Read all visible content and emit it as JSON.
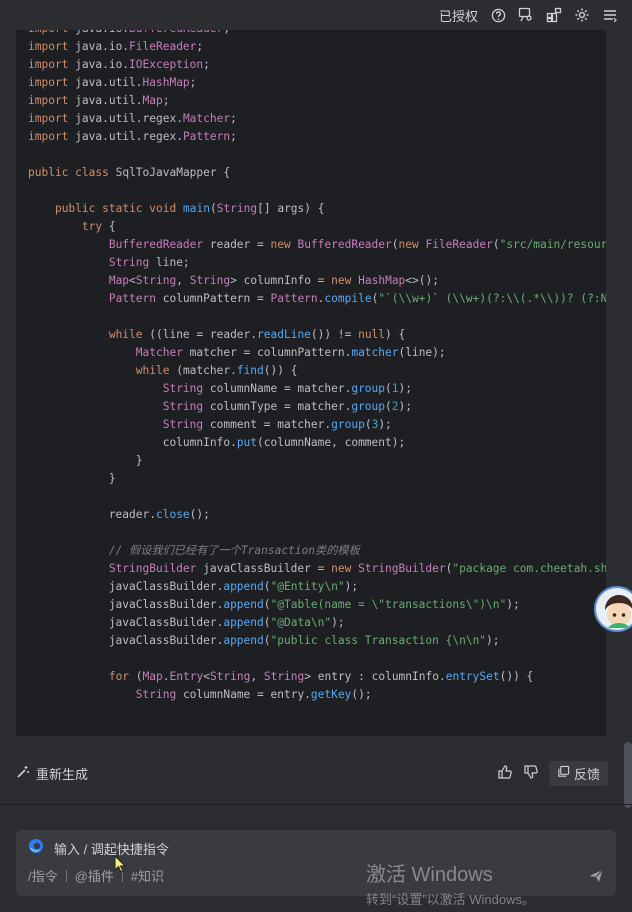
{
  "topbar": {
    "authorized_label": "已授权",
    "icons": [
      "help-icon",
      "chat-person-icon",
      "layout-grid-icon",
      "gear-icon",
      "menu-icon"
    ]
  },
  "code_lines": [
    "import java.io.BufferedReader;",
    "import java.io.FileReader;",
    "import java.io.IOException;",
    "import java.util.HashMap;",
    "import java.util.Map;",
    "import java.util.regex.Matcher;",
    "import java.util.regex.Pattern;",
    "",
    "public class SqlToJavaMapper {",
    "",
    "    public static void main(String[] args) {",
    "        try {",
    "            BufferedReader reader = new BufferedReader(new FileReader(\"src/main/resource",
    "            String line;",
    "            Map<String, String> columnInfo = new HashMap<>();",
    "            Pattern columnPattern = Pattern.compile(\"`(\\\\w+)` (\\\\w+)(?:\\\\(.*\\\\))? (?:NOT",
    "",
    "            while ((line = reader.readLine()) != null) {",
    "                Matcher matcher = columnPattern.matcher(line);",
    "                while (matcher.find()) {",
    "                    String columnName = matcher.group(1);",
    "                    String columnType = matcher.group(2);",
    "                    String comment = matcher.group(3);",
    "                    columnInfo.put(columnName, comment);",
    "                }",
    "            }",
    "",
    "            reader.close();",
    "",
    "            // 假设我们已经有了一个Transaction类的模板",
    "            StringBuilder javaClassBuilder = new StringBuilder(\"package com.cheetah.shir",
    "            javaClassBuilder.append(\"@Entity\\n\");",
    "            javaClassBuilder.append(\"@Table(name = \\\"transactions\\\")\\n\");",
    "            javaClassBuilder.append(\"@Data\\n\");",
    "            javaClassBuilder.append(\"public class Transaction {\\n\\n\");",
    "",
    "            for (Map.Entry<String, String> entry : columnInfo.entrySet()) {",
    "                String columnName = entry.getKey();"
  ],
  "actions": {
    "regenerate_label": "重新生成",
    "feedback_label": "反馈"
  },
  "input": {
    "placeholder": "输入 / 调起快捷指令",
    "tool_command": "/指令",
    "tool_plugin": "@插件",
    "tool_knowledge": "#知识"
  },
  "watermark": {
    "line1": "激活 Windows",
    "line2": "转到“设置”以激活 Windows。"
  }
}
